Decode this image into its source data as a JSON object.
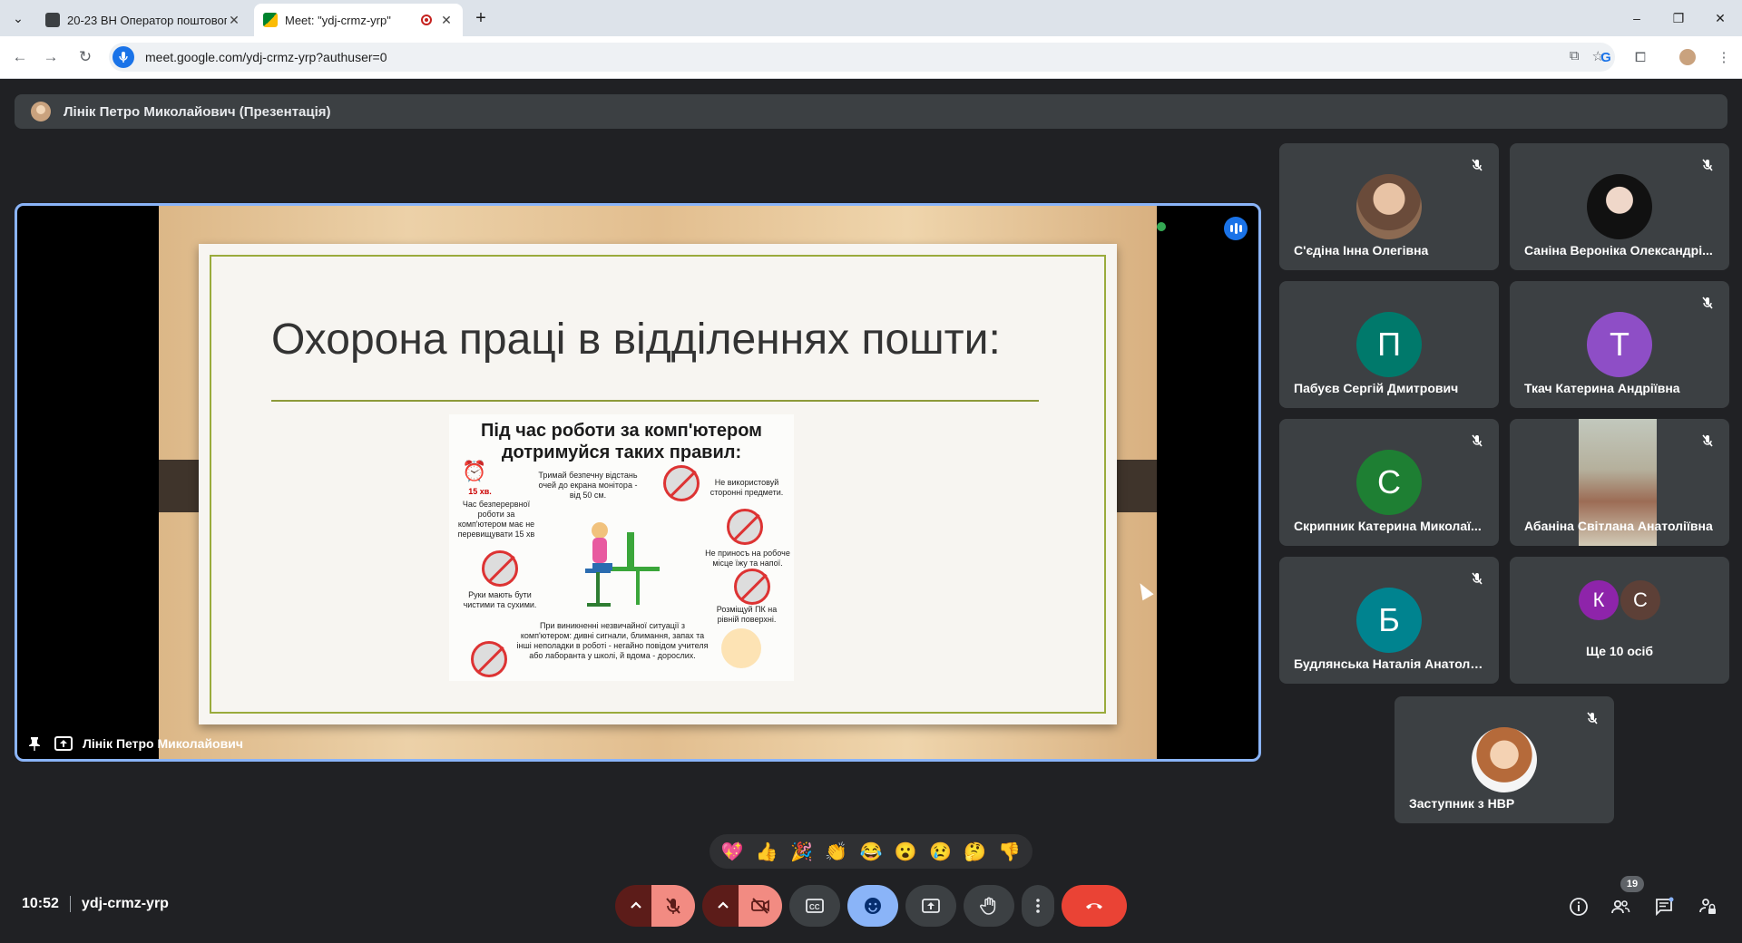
{
  "browser": {
    "tabs": [
      {
        "title": "20-23 ВН Оператор поштового",
        "active": false
      },
      {
        "title": "Meet: \"ydj-crmz-yrp\"",
        "active": true
      }
    ],
    "url": "meet.google.com/ydj-crmz-yrp?authuser=0",
    "window_controls": {
      "minimize": "–",
      "restore": "❐",
      "close": "✕"
    }
  },
  "presenter_bar": {
    "text": "Лінік Петро Миколайович (Презентація)"
  },
  "presentation": {
    "title": "Охорона праці  в відділеннях пошти:",
    "poster_heading_1": "Під час роботи за комп'ютером",
    "poster_heading_2": "дотримуйся таких  правил:",
    "poster_texts": [
      "15 хв.",
      "Час безперервної роботи за комп'ютером має не перевищувати 15 хв",
      "Тримай безпечну відстань очей  до екрана монітора - від 50 см.",
      "Не використовуй сторонні предмети.",
      "Не приносъ на робоче місце їжу та напої.",
      "Розміщуй ПК на рівній поверхні.",
      "Руки мають бути чистими та сухими.",
      "При виникненні незвичайної ситуації з комп'ютером: дивні сигнали, блимання, запах та інші неполадки в роботі - негайно повідом  учителя або лаборанта у школі, й вдома - дорослих."
    ],
    "presenter_label": "Лінік Петро Миколайович"
  },
  "participants": [
    {
      "name": "С'єдіна Інна Олегівна",
      "avatar": "photo",
      "muted": true
    },
    {
      "name": "Саніна Вероніка Олександрі...",
      "avatar": "photo",
      "muted": true
    },
    {
      "name": "Пабуєв Сергій Дмитрович",
      "avatar_letter": "П",
      "color": "#00796b",
      "muted": false
    },
    {
      "name": "Ткач Катерина Андріївна",
      "avatar_letter": "Т",
      "color": "#8e4ec6",
      "muted": true
    },
    {
      "name": "Скрипник Катерина Миколаї...",
      "avatar_letter": "С",
      "color": "#1e7f33",
      "muted": true
    },
    {
      "name": "Абаніна Світлана Анатоліївна",
      "avatar": "video",
      "muted": true
    },
    {
      "name": "Будлянська Наталія Анатолії...",
      "avatar_letter": "Б",
      "color": "#00838f",
      "muted": true
    },
    {
      "name": "Заступник з НВР",
      "avatar": "photo",
      "muted": true
    }
  ],
  "more_tile": {
    "label": "Ще 10 осіб",
    "letters": [
      "К",
      "С"
    ],
    "colors": [
      "#8e24aa",
      "#5d4037"
    ]
  },
  "reactions": [
    "💖",
    "👍",
    "🎉",
    "👏",
    "😂",
    "😮",
    "😢",
    "🤔",
    "👎"
  ],
  "footer": {
    "time": "10:52",
    "meeting_code": "ydj-crmz-yrp",
    "participant_count": "19"
  },
  "colors": {
    "accent": "#8ab4f8",
    "end_call": "#ea4335",
    "muted_control": "#f28b82",
    "active_control": "#8ab4f8"
  }
}
